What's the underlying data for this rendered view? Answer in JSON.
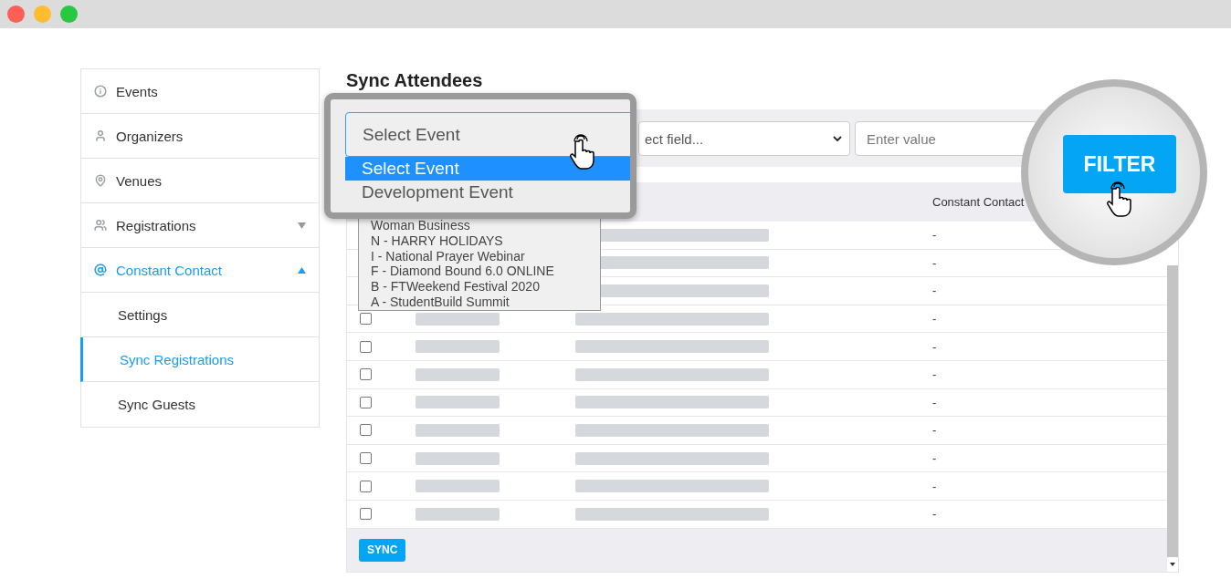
{
  "sidebar": {
    "items": [
      {
        "label": "Events",
        "selected": false
      },
      {
        "label": "Organizers",
        "selected": false
      },
      {
        "label": "Venues",
        "selected": false
      },
      {
        "label": "Registrations",
        "selected": false,
        "expanded": false
      },
      {
        "label": "Constant Contact",
        "selected": true,
        "expanded": true,
        "children": [
          {
            "label": "Settings",
            "selected": false
          },
          {
            "label": "Sync Registrations",
            "selected": true
          },
          {
            "label": "Sync Guests",
            "selected": false
          }
        ]
      }
    ]
  },
  "title": "Sync Attendees",
  "filter_bar": {
    "field_select": "ect field...",
    "value_input": {
      "placeholder": "Enter value"
    }
  },
  "table": {
    "columns": [
      "Constant Contact"
    ],
    "rows": [
      {
        "constant_contact": "-"
      },
      {
        "constant_contact": "-"
      },
      {
        "constant_contact": "-"
      },
      {
        "checked": false,
        "constant_contact": "-"
      },
      {
        "checked": false,
        "constant_contact": "-"
      },
      {
        "checked": false,
        "constant_contact": "-"
      },
      {
        "checked": false,
        "constant_contact": "-"
      },
      {
        "checked": false,
        "constant_contact": "-"
      },
      {
        "checked": false,
        "constant_contact": "-"
      },
      {
        "checked": false,
        "constant_contact": "-"
      },
      {
        "checked": false,
        "constant_contact": "-"
      }
    ],
    "sync_button": "SYNC"
  },
  "dropdown_list": {
    "options": [
      {
        "label": "Woman Business",
        "selected": false
      },
      {
        "label": "N - HARRY HOLIDAYS",
        "selected": false
      },
      {
        "label": "I - National Prayer Webinar",
        "selected": false
      },
      {
        "label": "F - Diamond Bound 6.0 ONLINE",
        "selected": false
      },
      {
        "label": "B - FTWeekend Festival 2020",
        "selected": false
      },
      {
        "label": "A - StudentBuild Summit",
        "selected": false
      }
    ]
  },
  "magnifier": {
    "select_value": "Select Event",
    "options": [
      {
        "label": "Select Event",
        "selected": true
      },
      {
        "label": "Development Event",
        "selected": false
      }
    ]
  },
  "filter_magnifier": {
    "button": "FILTER"
  }
}
